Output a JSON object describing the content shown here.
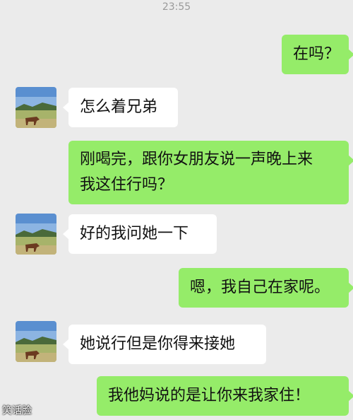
{
  "status_time": "23:55",
  "messages": [
    {
      "side": "out",
      "text": "在吗？"
    },
    {
      "side": "in",
      "text": "怎么着兄弟"
    },
    {
      "side": "out",
      "line1": "刚喝完，跟你女朋友说一声晚上来",
      "line2": "我这住行吗？"
    },
    {
      "side": "in",
      "text": "好的我问她一下"
    },
    {
      "side": "out",
      "text": "嗯，我自己在家呢。"
    },
    {
      "side": "in",
      "text": "她说行但是你得来接她"
    },
    {
      "side": "out",
      "text": "我他妈说的是让你来我家住！"
    }
  ],
  "watermark": "笑话脸",
  "colors": {
    "outgoing_bubble": "#95ec69",
    "incoming_bubble": "#ffffff",
    "background": "#ebebeb"
  },
  "avatar_icon": "landscape-with-horse-avatar"
}
